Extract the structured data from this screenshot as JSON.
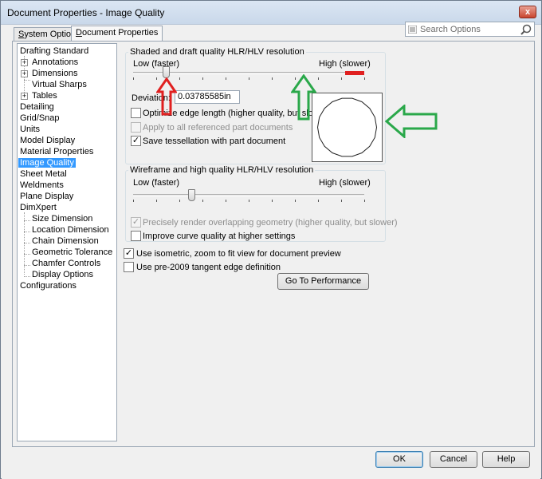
{
  "window": {
    "title": "Document Properties - Image Quality",
    "close_glyph": "x"
  },
  "tabs": [
    {
      "label": "System Options",
      "accel": "S",
      "rest": "ystem Options"
    },
    {
      "label": "Document Properties",
      "accel": "D",
      "rest": "ocument Properties"
    }
  ],
  "search": {
    "placeholder": "Search Options"
  },
  "tree": {
    "items": [
      {
        "label": "Drafting Standard"
      },
      {
        "label": "Annotations"
      },
      {
        "label": "Dimensions"
      },
      {
        "label": "Virtual Sharps"
      },
      {
        "label": "Tables"
      },
      {
        "label": "Detailing"
      },
      {
        "label": "Grid/Snap"
      },
      {
        "label": "Units"
      },
      {
        "label": "Model Display"
      },
      {
        "label": "Material Properties"
      },
      {
        "label": "Image Quality"
      },
      {
        "label": "Sheet Metal"
      },
      {
        "label": "Weldments"
      },
      {
        "label": "Plane Display"
      },
      {
        "label": "DimXpert"
      },
      {
        "label": "Size Dimension"
      },
      {
        "label": "Location Dimension"
      },
      {
        "label": "Chain Dimension"
      },
      {
        "label": "Geometric Tolerance"
      },
      {
        "label": "Chamfer Controls"
      },
      {
        "label": "Display Options"
      },
      {
        "label": "Configurations"
      }
    ],
    "selected": "Image Quality"
  },
  "shaded": {
    "group_title": "Shaded and draft quality HLR/HLV resolution",
    "low_label": "Low (faster)",
    "high_label": "High (slower)",
    "slider_value": 0.14,
    "deviation_label": "Deviation:",
    "deviation_value": "0.03785585in",
    "optimize_label": "Optimize edge length (higher quality, but slower)",
    "optimize_checked": false,
    "apply_label": "Apply to all referenced part documents",
    "apply_checked": false,
    "apply_disabled": true,
    "save_tess_label": "Save tessellation with part document",
    "save_tess_checked": true
  },
  "wireframe": {
    "group_title": "Wireframe and high quality HLR/HLV resolution",
    "low_label": "Low (faster)",
    "high_label": "High (slower)",
    "slider_value": 0.25,
    "precisely_label": "Precisely render overlapping geometry (higher quality, but slower)",
    "precisely_checked": true,
    "precisely_disabled": true,
    "improve_label": "Improve curve quality at higher settings",
    "improve_checked": false
  },
  "options": {
    "isometric_label": "Use isometric, zoom to fit view for document preview",
    "isometric_checked": true,
    "pre2009_label": "Use pre-2009 tangent edge definition",
    "pre2009_checked": false,
    "performance_button": "Go To Performance"
  },
  "footer": {
    "ok": "OK",
    "cancel": "Cancel",
    "help": "Help"
  },
  "annotations": {
    "red_arrow_color": "#e02020",
    "green_arrow_color": "#2aa84a"
  },
  "check_glyph": "✓"
}
